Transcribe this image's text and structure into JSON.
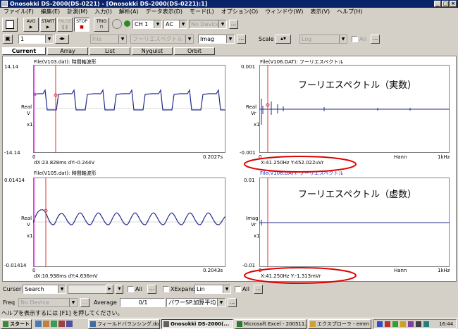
{
  "window": {
    "title": "Onosokki DS-2000(DS-0221) - [Onosokki DS-2000(DS-0221):1]"
  },
  "menu": [
    "ファイル(F)",
    "編集(E)",
    "計測(M)",
    "入力(I)",
    "解析(A)",
    "データ表示(D)",
    "モード(L)",
    "オプション(O)",
    "ウィンドウ(W)",
    "表示(V)",
    "ヘルプ(H)"
  ],
  "toolbar": {
    "avg": "AVG",
    "start": "START",
    "pause": "PAUSE",
    "stop": "STOP",
    "trig": "TRIG",
    "channel": "CH 1",
    "coupling": "AC",
    "device": "No Device",
    "more": "...",
    "frame": "1",
    "file_label": "File",
    "spectrum_label": "フーリエスペクトル",
    "imag": "Imag",
    "scale_label": "Scale",
    "scale_value": "Log",
    "all_label": "All"
  },
  "tabs": [
    "Current",
    "Array",
    "List",
    "Nyquist",
    "Orbit"
  ],
  "panels": [
    {
      "file": "File(V103.dat): 時間軸波形",
      "ymax": "14.14",
      "ymin": "-14.14",
      "ylabel": "Real",
      "yunit": "V",
      "xmul": "x1",
      "xstart": "0",
      "xend": "0.2027s",
      "readout": "dX:23.828ms dY:-0.244V"
    },
    {
      "file": "File(V106.DAT): フーリエスペクトル",
      "ymax": "0.001",
      "ymin": "-0.001",
      "ylabel": "Real",
      "yunit": "Vr",
      "xmul": "x1",
      "xstart": "0",
      "window": "Hann",
      "xend": "1kHz",
      "readout": "X:41.250Hz Y:452.022uVr",
      "annotation": "フーリエスペクトル（実数）"
    },
    {
      "file": "File(V105.dat): 時間軸波形",
      "ymax": "0.01414",
      "ymin": "-0.01414",
      "ylabel": "Real",
      "yunit": "V",
      "xmul": "x1",
      "xstart": "0",
      "xend": "0.2043s",
      "readout": "dX:10.938ms dY:4.636mV"
    },
    {
      "file": "File(V106.DAT): フーリエスペクトル",
      "ymax": "0.01",
      "ymin": "-0.01",
      "ylabel": "Imag",
      "yunit": "Vr",
      "xmul": "x1",
      "xstart": "0",
      "window": "Hann",
      "xend": "1kHz",
      "readout": "X:41.250Hz Y:-1.313mVr",
      "annotation": "フーリエスペクトル（虚数）"
    }
  ],
  "cursorbar": {
    "label": "Cursor",
    "value": "Search",
    "all": "All",
    "xexpand": "XExpand",
    "xexpand_value": "Lin",
    "all2": "All"
  },
  "freqbar": {
    "label": "Freq",
    "device": "No Device",
    "average_label": "Average",
    "average_value": "0/1",
    "mode": "パワーSP.加算平均"
  },
  "status": "ヘルプを表示するには [F1] を押してください。",
  "taskbar": {
    "start": "スタート",
    "items": [
      "フィールドバランシング.doc -",
      "Onosokki DS-2000(...",
      "Microsoft Excel - 200511..",
      "エクスプローラ - emm"
    ],
    "clock": "16:44"
  }
}
